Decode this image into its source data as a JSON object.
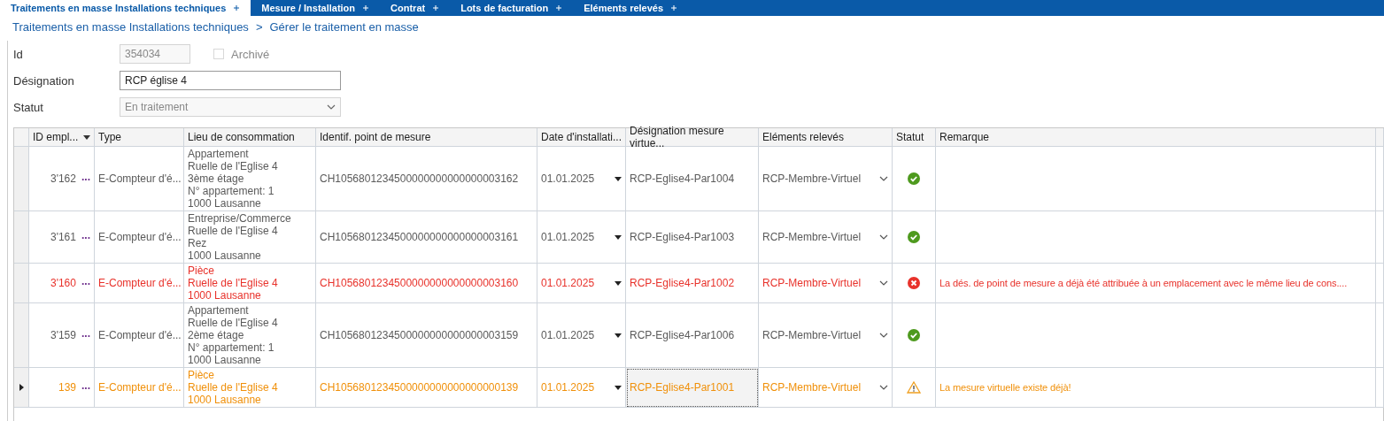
{
  "tabs": [
    {
      "label": "Traitements en masse Installations techniques",
      "selected": true
    },
    {
      "label": "Mesure / Installation",
      "selected": false
    },
    {
      "label": "Contrat",
      "selected": false
    },
    {
      "label": "Lots de facturation",
      "selected": false
    },
    {
      "label": "Eléments relevés",
      "selected": false
    }
  ],
  "breadcrumb": {
    "parent": "Traitements en masse Installations techniques",
    "separator": ">",
    "current": "Gérer le traitement en masse"
  },
  "form": {
    "id": {
      "label": "Id",
      "value": "354034",
      "disabled": true
    },
    "archived": {
      "label": "Archivé",
      "checked": false,
      "disabled": true
    },
    "designation": {
      "label": "Désignation",
      "value": "RCP église 4"
    },
    "status": {
      "label": "Statut",
      "value": "En traitement",
      "disabled": true
    }
  },
  "table": {
    "columns": [
      {
        "label": "ID empl...",
        "menu": true
      },
      {
        "label": "Type",
        "menu": false
      },
      {
        "label": "Lieu de consommation",
        "menu": false
      },
      {
        "label": "Identif. point de mesure",
        "menu": false
      },
      {
        "label": "Date d'installati...",
        "menu": false
      },
      {
        "label": "Désignation mesure virtue...",
        "menu": false
      },
      {
        "label": "Eléments relevés",
        "menu": false
      },
      {
        "label": "Statut",
        "menu": false
      },
      {
        "label": "Remarque",
        "menu": false
      }
    ],
    "rows": [
      {
        "current": false,
        "kind": "ok",
        "more": "...",
        "id": "3'162",
        "type": "E-Compteur d'é...",
        "location": [
          "Appartement",
          "Ruelle de l'Eglise 4",
          "3ème étage",
          "N° appartement: 1",
          "1000 Lausanne"
        ],
        "point": "CH1056801234500000000000000003162",
        "date": "01.01.2025",
        "designation": "RCP-Eglise4-Par1004",
        "elements": "RCP-Membre-Virtuel"
      },
      {
        "current": false,
        "kind": "ok",
        "more": "...",
        "id": "3'161",
        "type": "E-Compteur d'é...",
        "location": [
          "Entreprise/Commerce",
          "Ruelle de l'Eglise 4",
          "Rez",
          "1000 Lausanne"
        ],
        "point": "CH1056801234500000000000000003161",
        "date": "01.01.2025",
        "designation": "RCP-Eglise4-Par1003",
        "elements": "RCP-Membre-Virtuel"
      },
      {
        "current": false,
        "kind": "error",
        "more": "...",
        "id": "3'160",
        "type": "E-Compteur d'é...",
        "location": [
          "Pièce",
          "Ruelle de l'Eglise 4",
          "1000 Lausanne"
        ],
        "point": "CH1056801234500000000000000003160",
        "date": "01.01.2025",
        "designation": "RCP-Eglise4-Par1002",
        "elements": "RCP-Membre-Virtuel",
        "remark": "La dés. de point de mesure a déjà été attribuée à un emplacement avec le même lieu de cons...."
      },
      {
        "current": false,
        "kind": "ok",
        "more": "...",
        "id": "3'159",
        "type": "E-Compteur d'é...",
        "location": [
          "Appartement",
          "Ruelle de l'Eglise 4",
          "2ème étage",
          "N° appartement: 1",
          "1000 Lausanne"
        ],
        "point": "CH1056801234500000000000000003159",
        "date": "01.01.2025",
        "designation": "RCP-Eglise4-Par1006",
        "elements": "RCP-Membre-Virtuel"
      },
      {
        "current": true,
        "kind": "warning",
        "more": "...",
        "id": "139",
        "type": "E-Compteur d'é...",
        "location": [
          "Pièce",
          "Ruelle de l'Eglise 4",
          "1000 Lausanne"
        ],
        "point": "CH1056801234500000000000000000139",
        "date": "01.01.2025",
        "designation": "RCP-Eglise4-Par1001",
        "elements": "RCP-Membre-Virtuel",
        "remark": "La mesure virtuelle existe déjà!"
      }
    ]
  }
}
